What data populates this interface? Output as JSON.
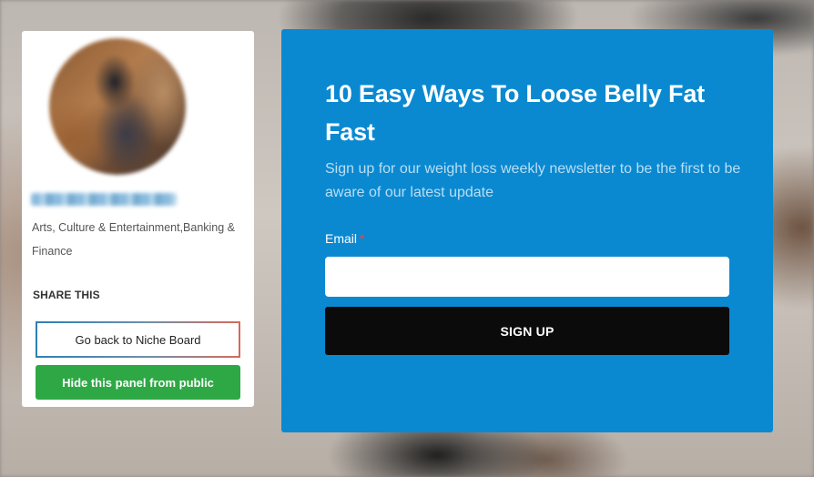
{
  "profile": {
    "categories": "Arts, Culture & Entertainment,Banking & Finance",
    "share_label": "SHARE THIS",
    "back_button": "Go back to Niche Board",
    "hide_button": "Hide this panel from public"
  },
  "newsletter": {
    "title": "10 Easy Ways To Loose Belly Fat Fast",
    "subtitle": "Sign up for our weight loss weekly newsletter to be the first to be aware of our latest update",
    "email_label": "Email",
    "required_mark": "*",
    "email_value": "",
    "signup_button": "SIGN UP"
  },
  "colors": {
    "panel_blue": "#0a89d1",
    "signup_button": "#0b0b0b",
    "hide_button": "#2ea845",
    "required_star": "#e8464b"
  }
}
